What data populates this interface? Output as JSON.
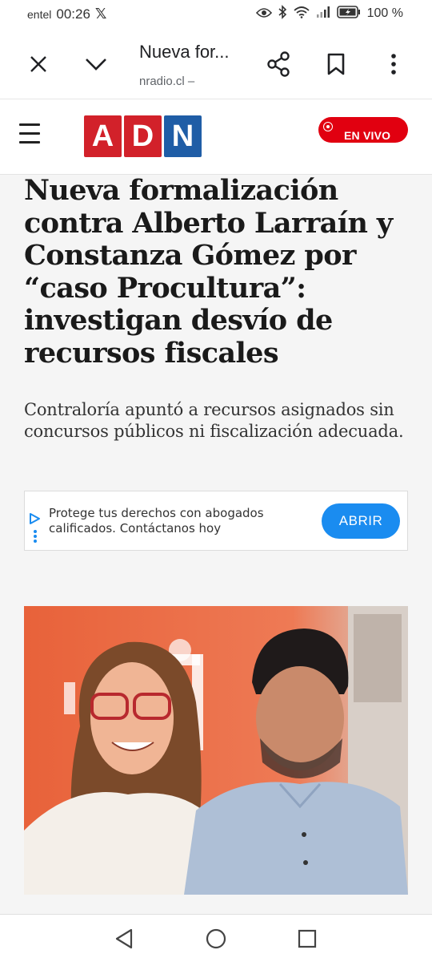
{
  "status_bar": {
    "carrier": "entel",
    "time": "00:26",
    "battery": "100 %",
    "icons": [
      "x-logo-icon",
      "eye-icon",
      "bluetooth-icon",
      "wifi-icon",
      "signal-icon",
      "battery-icon"
    ]
  },
  "browser": {
    "tab_title": "Nueva for...",
    "url": "nradio.cl –"
  },
  "site": {
    "logo_letters": [
      "A",
      "D",
      "N"
    ],
    "logo_colors": [
      "#d2212a",
      "#d2212a",
      "#1f5da6"
    ],
    "live_label": "EN VIVO",
    "live_color": "#e10010"
  },
  "article": {
    "headline": "Nueva formalización contra Alberto Larraín y Constanza Gómez por “caso Procultura”: investigan desvío de recursos fiscales",
    "summary": "Contraloría apuntó a recursos asignados sin concursos públicos ni fiscalización adecuada."
  },
  "ad": {
    "text": "Protege tus derechos con abogados calificados. Contáctanos hoy",
    "button": "ABRIR",
    "button_color": "#1a8cf0"
  }
}
